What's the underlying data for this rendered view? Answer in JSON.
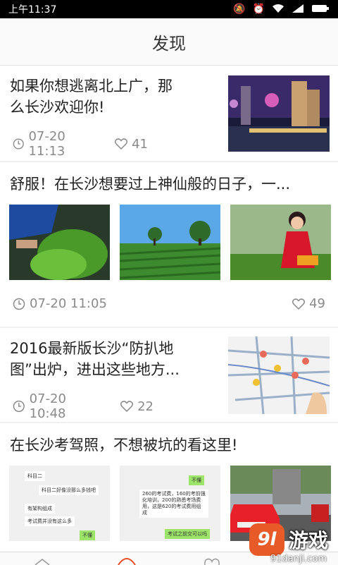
{
  "status_bar": {
    "time": "上午11:37",
    "icons": [
      "mute-icon",
      "alarm-icon",
      "wifi-icon",
      "signal-icon",
      "battery-icon"
    ]
  },
  "header": {
    "title": "发现"
  },
  "feed": [
    {
      "title": "如果你想逃离北上广，那么长沙欢迎你!",
      "date": "07-20 11:13",
      "likes": "41"
    },
    {
      "title": "舒服！在长沙想要过上神仙般的日子，一...",
      "date": "07-20 11:05",
      "likes": "49"
    },
    {
      "title": "2016最新版长沙“防扒地图”出炉，进出这些地方...",
      "date": "07-20 10:48",
      "likes": "22"
    },
    {
      "title": "在长沙考驾照，不想被坑的看这里!"
    }
  ],
  "chat_thumbs": {
    "left": [
      "科目二",
      "科目二好像没那么多钱吧",
      "有架构组成",
      "考试费并没有这么多",
      "不懂"
    ],
    "mid": [
      "不懂",
      "260的考试费，160的考前强化培训，200的熟悉考场费用，这是620的考试费用组成",
      "考试之前交可以吗"
    ]
  },
  "watermark": {
    "logo": "9l",
    "name": "游戏",
    "url": "91danji.com"
  }
}
